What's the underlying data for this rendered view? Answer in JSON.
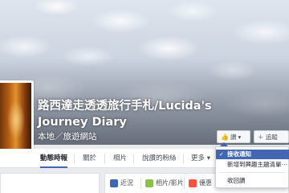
{
  "page": {
    "title": "路西達走透透旅行手札/Lucida's Journey Diary",
    "category": "本地／旅遊網站"
  },
  "actions": {
    "like_label": "讚",
    "follow_label": "＋ 追蹤"
  },
  "dropdown": {
    "items": [
      {
        "label": "接收通知",
        "checked": true
      },
      {
        "label": "新增到興趣主題清單⋯",
        "checked": false
      },
      {
        "label": "收回讚",
        "checked": false
      }
    ]
  },
  "nav": {
    "tabs": [
      "動態時報",
      "關於",
      "相片",
      "說讚的粉絲",
      "更多 ▾"
    ]
  },
  "composer": {
    "post": "近況",
    "photo": "相片/影片",
    "offer": "優惠"
  },
  "colors": {
    "accent": "#4267b2"
  }
}
